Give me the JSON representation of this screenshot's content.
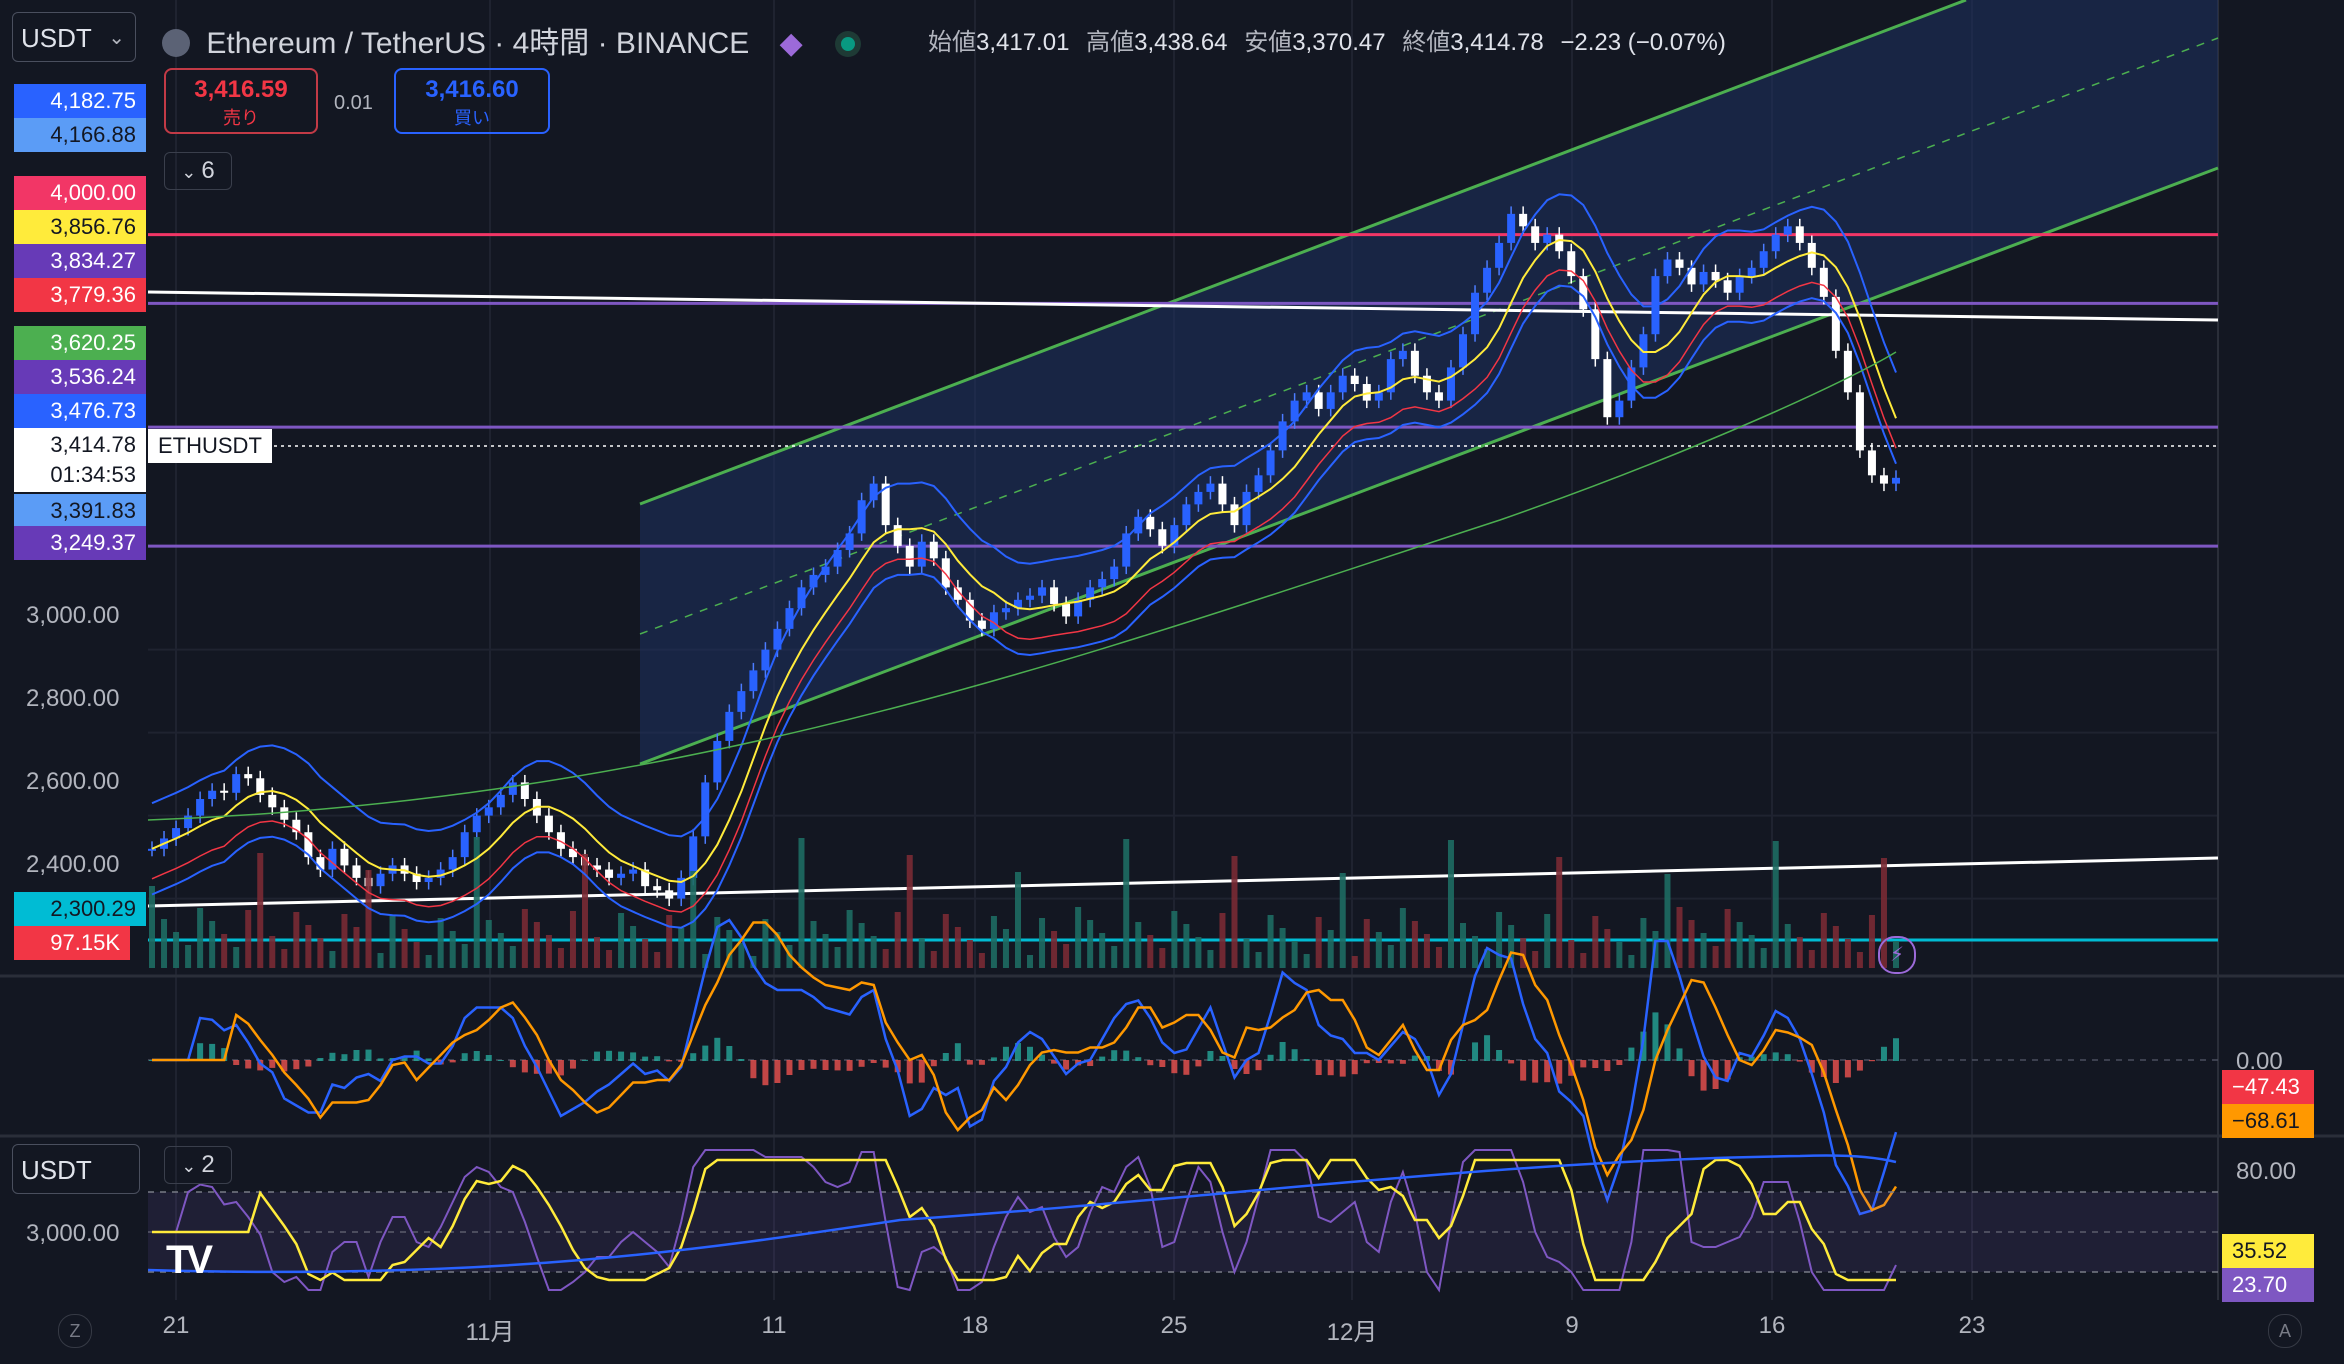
{
  "header": {
    "currency": "USDT",
    "title": "Ethereum / TetherUS · 4時間 · BINANCE",
    "ohlc": [
      {
        "label": "始値",
        "value": "3,417.01"
      },
      {
        "label": "高値",
        "value": "3,438.64"
      },
      {
        "label": "安値",
        "value": "3,370.47"
      },
      {
        "label": "終値",
        "value": "3,414.78"
      }
    ],
    "change": "−2.23 (−0.07%)"
  },
  "trade": {
    "sell_price": "3,416.59",
    "sell_label": "売り",
    "spread": "0.01",
    "buy_price": "3,416.60",
    "buy_label": "買い"
  },
  "indicators": {
    "count_label": "6",
    "rsi_count_label": "2"
  },
  "price_scale": {
    "ticks": [
      "3,000.00",
      "2,800.00",
      "2,600.00",
      "2,400.00"
    ],
    "badges": [
      {
        "text": "4,182.75",
        "bg": "#2962ff",
        "fg": "#ffffff"
      },
      {
        "text": "4,166.88",
        "bg": "#5b9cf6",
        "fg": "#131722"
      },
      {
        "text": "4,000.00",
        "bg": "#f23666",
        "fg": "#ffffff"
      },
      {
        "text": "3,856.76",
        "bg": "#ffeb3b",
        "fg": "#131722"
      },
      {
        "text": "3,834.27",
        "bg": "#673ab7",
        "fg": "#ffffff"
      },
      {
        "text": "3,779.36",
        "bg": "#f23645",
        "fg": "#ffffff"
      },
      {
        "text": "3,620.25",
        "bg": "#4caf50",
        "fg": "#ffffff"
      },
      {
        "text": "3,536.24",
        "bg": "#673ab7",
        "fg": "#ffffff"
      },
      {
        "text": "3,476.73",
        "bg": "#2962ff",
        "fg": "#ffffff"
      },
      {
        "text": "3,414.78",
        "bg": "#ffffff",
        "fg": "#131722"
      },
      {
        "text": "01:34:53",
        "bg": "#ffffff",
        "fg": "#131722"
      },
      {
        "text": "3,391.83",
        "bg": "#5b9cf6",
        "fg": "#131722"
      },
      {
        "text": "3,249.37",
        "bg": "#673ab7",
        "fg": "#ffffff"
      },
      {
        "text": "2,300.29",
        "bg": "#00bcd4",
        "fg": "#131722"
      },
      {
        "text": "97.15K",
        "bg": "#f23645",
        "fg": "#ffffff"
      }
    ],
    "symbol_label": "ETHUSDT"
  },
  "macd_scale": {
    "zero": "0.00",
    "badges": [
      {
        "text": "−47.43",
        "bg": "#f23645",
        "fg": "#ffffff"
      },
      {
        "text": "−68.61",
        "bg": "#ff9800",
        "fg": "#131722"
      }
    ]
  },
  "rsi_scale": {
    "currency": "USDT",
    "left_tick": "3,000.00",
    "ticks": [
      "80.00"
    ],
    "badges": [
      {
        "text": "35.52",
        "bg": "#ffeb3b",
        "fg": "#131722"
      },
      {
        "text": "23.70",
        "bg": "#7e57c2",
        "fg": "#ffffff"
      }
    ]
  },
  "time_axis": [
    "21",
    "11月",
    "11",
    "18",
    "25",
    "12月",
    "9",
    "16",
    "23"
  ],
  "bottom_left_button": "Z",
  "bottom_right_button": "A",
  "chart_data": {
    "type": "candlestick",
    "symbol": "ETHUSDT",
    "timeframe": "4時間",
    "ylim": [
      2250,
      4300
    ],
    "levels": [
      {
        "price": 4000.0,
        "color": "#f23666"
      },
      {
        "price": 3834.27,
        "color": "#7e57c2"
      },
      {
        "price": 3536.24,
        "color": "#7e57c2"
      },
      {
        "price": 3249.37,
        "color": "#7e57c2"
      },
      {
        "price": 2300.29,
        "color": "#00bcd4"
      }
    ],
    "closes": [
      2520,
      2545,
      2570,
      2600,
      2640,
      2660,
      2655,
      2700,
      2690,
      2650,
      2620,
      2590,
      2560,
      2500,
      2470,
      2520,
      2480,
      2450,
      2430,
      2460,
      2480,
      2460,
      2440,
      2450,
      2470,
      2500,
      2560,
      2600,
      2620,
      2650,
      2680,
      2640,
      2600,
      2560,
      2520,
      2500,
      2480,
      2470,
      2450,
      2460,
      2470,
      2430,
      2420,
      2400,
      2450,
      2550,
      2680,
      2780,
      2850,
      2900,
      2950,
      3000,
      3050,
      3100,
      3150,
      3180,
      3200,
      3240,
      3280,
      3360,
      3400,
      3300,
      3250,
      3200,
      3260,
      3220,
      3150,
      3120,
      3070,
      3050,
      3090,
      3100,
      3120,
      3130,
      3150,
      3110,
      3080,
      3120,
      3150,
      3170,
      3200,
      3280,
      3320,
      3290,
      3250,
      3300,
      3350,
      3380,
      3400,
      3350,
      3300,
      3380,
      3420,
      3480,
      3550,
      3600,
      3620,
      3580,
      3620,
      3660,
      3640,
      3600,
      3620,
      3700,
      3720,
      3660,
      3620,
      3600,
      3680,
      3760,
      3860,
      3920,
      3980,
      4050,
      4020,
      3980,
      4000,
      3960,
      3900,
      3820,
      3700,
      3560,
      3600,
      3680,
      3760,
      3900,
      3940,
      3920,
      3880,
      3910,
      3890,
      3860,
      3900,
      3920,
      3960,
      4000,
      4020,
      3980,
      3920,
      3850,
      3720,
      3620,
      3480,
      3420,
      3400,
      3414
    ]
  }
}
